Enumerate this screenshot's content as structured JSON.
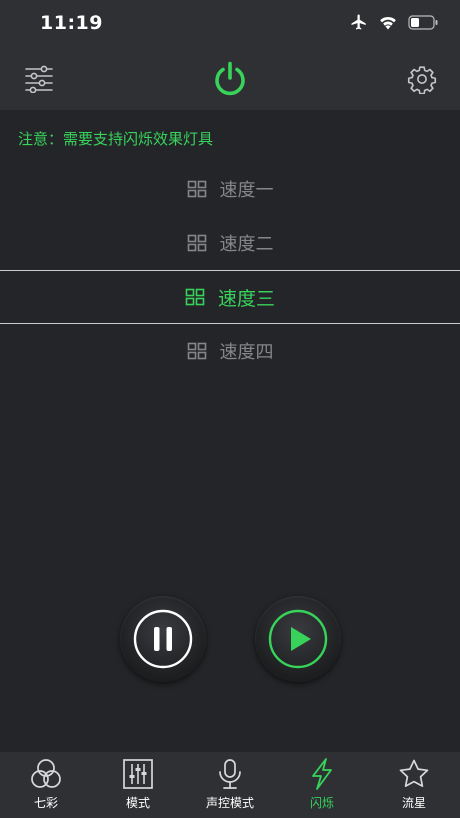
{
  "status_bar": {
    "time": "11:19"
  },
  "notice": "注意：需要支持闪烁效果灯具",
  "speeds": [
    {
      "label": "速度一",
      "selected": false
    },
    {
      "label": "速度二",
      "selected": false
    },
    {
      "label": "速度三",
      "selected": true
    },
    {
      "label": "速度四",
      "selected": false
    }
  ],
  "tabs": [
    {
      "label": "七彩",
      "icon": "color-circles-icon",
      "active": false
    },
    {
      "label": "模式",
      "icon": "sliders-icon",
      "active": false
    },
    {
      "label": "声控模式",
      "icon": "microphone-icon",
      "active": false
    },
    {
      "label": "闪烁",
      "icon": "lightning-icon",
      "active": true
    },
    {
      "label": "流星",
      "icon": "star-icon",
      "active": false
    }
  ],
  "colors": {
    "accent": "#37d35b",
    "background": "#242528",
    "bar": "#2f3034",
    "muted_text": "#85868a"
  }
}
